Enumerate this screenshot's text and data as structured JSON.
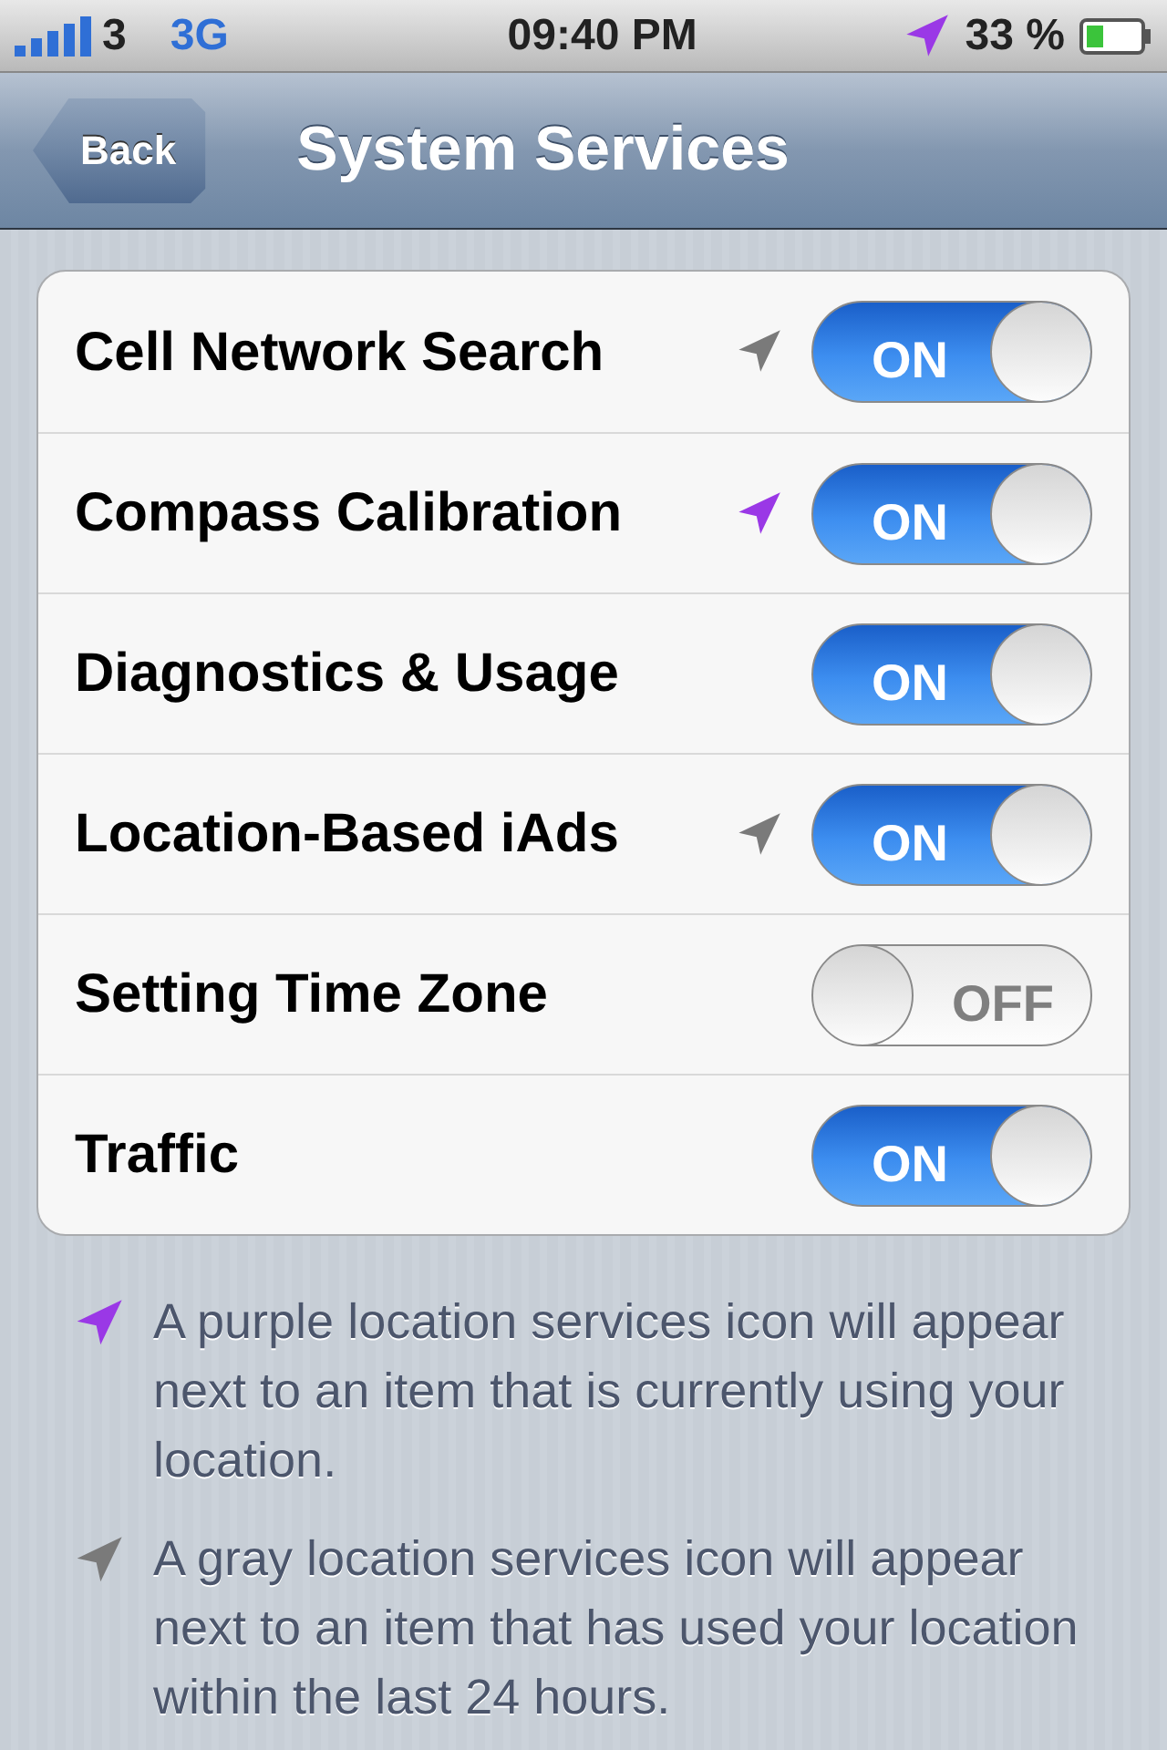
{
  "status_bar": {
    "carrier": "3",
    "network": "3G",
    "time": "09:40 PM",
    "location_icon": {
      "color": "#9a38e6"
    },
    "battery": "33 %"
  },
  "nav": {
    "back": "Back",
    "title": "System Services"
  },
  "rows": [
    {
      "label": "Cell Network Search",
      "location_icon": {
        "color": "#7a7a7a"
      },
      "on": true,
      "toggle_text": "ON"
    },
    {
      "label": "Compass Calibration",
      "location_icon": {
        "color": "#9a38e6"
      },
      "on": true,
      "toggle_text": "ON"
    },
    {
      "label": "Diagnostics & Usage",
      "on": true,
      "toggle_text": "ON"
    },
    {
      "label": "Location-Based iAds",
      "location_icon": {
        "color": "#7a7a7a"
      },
      "on": true,
      "toggle_text": "ON"
    },
    {
      "label": "Setting Time Zone",
      "on": false,
      "toggle_text": "OFF"
    },
    {
      "label": "Traffic",
      "on": true,
      "toggle_text": "ON"
    }
  ],
  "notes": [
    {
      "location_icon": {
        "color": "#9a38e6"
      },
      "text": "A purple location services icon will appear next to an item that is currently using your location."
    },
    {
      "location_icon": {
        "color": "#7a7a7a"
      },
      "text": "A gray location services icon will appear next to an item that has used your location within the last 24 hours."
    }
  ]
}
